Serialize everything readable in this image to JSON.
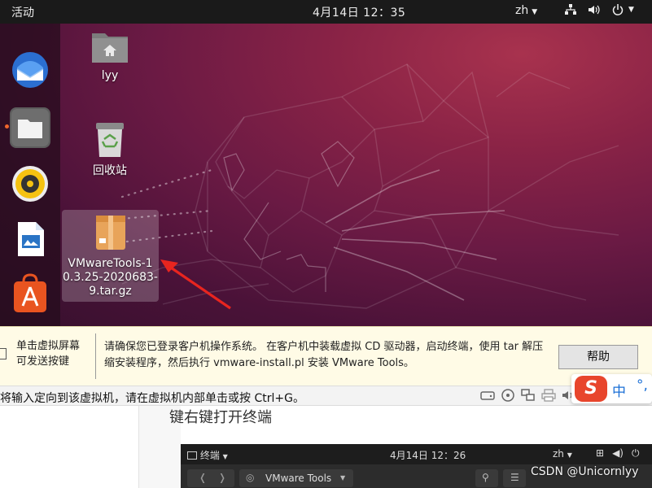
{
  "topbar": {
    "activities": "活动",
    "clock": "4月14日  12：35",
    "lang": "zh",
    "network_icon": "network-icon",
    "volume_icon": "volume-icon",
    "power_icon": "power-icon"
  },
  "dock": {
    "items": [
      "thunderbird-icon",
      "files-icon",
      "rhythmbox-icon",
      "libreoffice-writer-icon",
      "software-center-icon"
    ]
  },
  "desktop": {
    "icons": [
      {
        "label": "lyy",
        "icon": "home-folder-icon"
      },
      {
        "label": "回收站",
        "icon": "trash-icon"
      },
      {
        "label": "VMwareTools-10.3.25-20206839.tar.gz",
        "label_lines": [
          "VMwareTools-1",
          "0.3.25-2020683-",
          "9.tar.gz"
        ],
        "icon": "archive-icon"
      }
    ]
  },
  "hint": {
    "left_line1": "单击虚拟屏幕",
    "left_line2": "可发送按键",
    "message": "请确保您已登录客户机操作系统。 在客户机中装载虚拟 CD 驱动器，启动终端，使用 tar 解压缩安装程序，然后执行 vmware-install.pl 安装 VMware Tools。",
    "help_button": "帮助"
  },
  "statusbar": {
    "text": "将输入定向到该虚拟机，请在虚拟机内部单击或按 Ctrl+G。",
    "device_icons": [
      "hdd-icon",
      "cdrom-icon",
      "network-adapter-icon",
      "printer-icon",
      "sound-icon"
    ]
  },
  "ime": {
    "logo": "S",
    "mode": "中",
    "punct": "°,"
  },
  "lower": {
    "doc_text": "键右键打开终端"
  },
  "terminal": {
    "app_name": "终端",
    "clock": "4月14日  12：26",
    "lang": "zh",
    "path": "VMware Tools"
  },
  "watermark": "CSDN @Unicornlyy",
  "colors": {
    "ubuntu_orange": "#e95420",
    "hint_bg": "#fffbe6",
    "sogou_red": "#e8452c",
    "sogou_blue": "#1a6fd6"
  }
}
